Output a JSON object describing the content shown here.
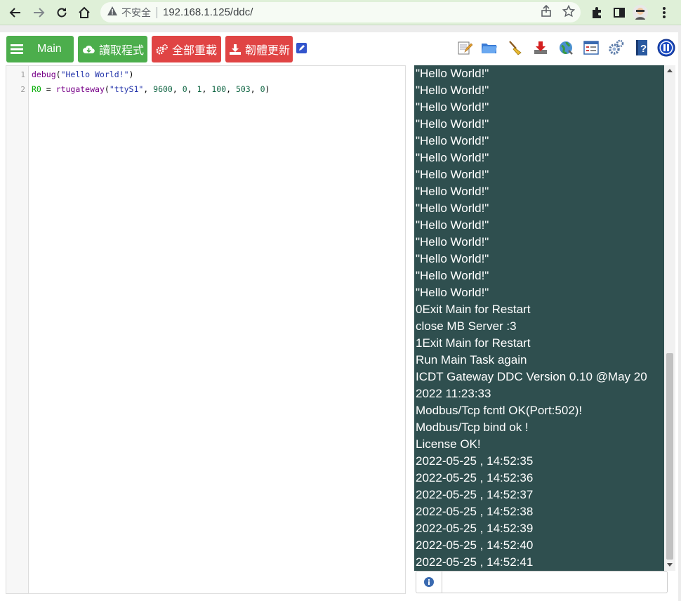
{
  "browser": {
    "insecure_label": "不安全",
    "url": "192.168.1.125/ddc/"
  },
  "toolbar": {
    "main_label": "Main",
    "read_label": "讀取程式",
    "reload_label": "全部重載",
    "firmware_label": "韌體更新"
  },
  "editor": {
    "lines": [
      {
        "num": "1",
        "tokens": [
          {
            "t": "debug",
            "c": "kw"
          },
          {
            "t": "(",
            "c": "plain"
          },
          {
            "t": "\"Hello World!\"",
            "c": "str2"
          },
          {
            "t": ")",
            "c": "plain"
          }
        ]
      },
      {
        "num": "2",
        "tokens": [
          {
            "t": "R0",
            "c": "var"
          },
          {
            "t": " = ",
            "c": "plain"
          },
          {
            "t": "rtugateway",
            "c": "kw"
          },
          {
            "t": "(",
            "c": "plain"
          },
          {
            "t": "\"ttyS1\"",
            "c": "str2"
          },
          {
            "t": ", ",
            "c": "plain"
          },
          {
            "t": "9600",
            "c": "num"
          },
          {
            "t": ", ",
            "c": "plain"
          },
          {
            "t": "0",
            "c": "num"
          },
          {
            "t": ", ",
            "c": "plain"
          },
          {
            "t": "1",
            "c": "num"
          },
          {
            "t": ", ",
            "c": "plain"
          },
          {
            "t": "100",
            "c": "num"
          },
          {
            "t": ", ",
            "c": "plain"
          },
          {
            "t": "503",
            "c": "num"
          },
          {
            "t": ", ",
            "c": "plain"
          },
          {
            "t": "0",
            "c": "num"
          },
          {
            "t": ")",
            "c": "plain"
          }
        ]
      }
    ]
  },
  "console": {
    "lines": [
      "\"Hello World!\"",
      "\"Hello World!\"",
      "\"Hello World!\"",
      "\"Hello World!\"",
      "\"Hello World!\"",
      "\"Hello World!\"",
      "\"Hello World!\"",
      "\"Hello World!\"",
      "\"Hello World!\"",
      "\"Hello World!\"",
      "\"Hello World!\"",
      "\"Hello World!\"",
      "\"Hello World!\"",
      "\"Hello World!\"",
      "0Exit Main for Restart",
      "close MB Server :3",
      "1Exit Main for Restart",
      "Run Main Task again",
      "ICDT Gateway DDC Version 0.10 @May 20",
      "2022 11:23:33",
      "Modbus/Tcp fcntl OK(Port:502)!",
      "Modbus/Tcp bind ok !",
      "License OK!",
      "2022-05-25 , 14:52:35",
      "2022-05-25 , 14:52:36",
      "2022-05-25 , 14:52:37",
      "2022-05-25 , 14:52:38",
      "2022-05-25 , 14:52:39",
      "2022-05-25 , 14:52:40",
      "2022-05-25 , 14:52:41"
    ],
    "input_value": ""
  },
  "colors": {
    "console_bg": "#2f4f4f",
    "green": "#4cae4c",
    "red": "#e04444"
  }
}
